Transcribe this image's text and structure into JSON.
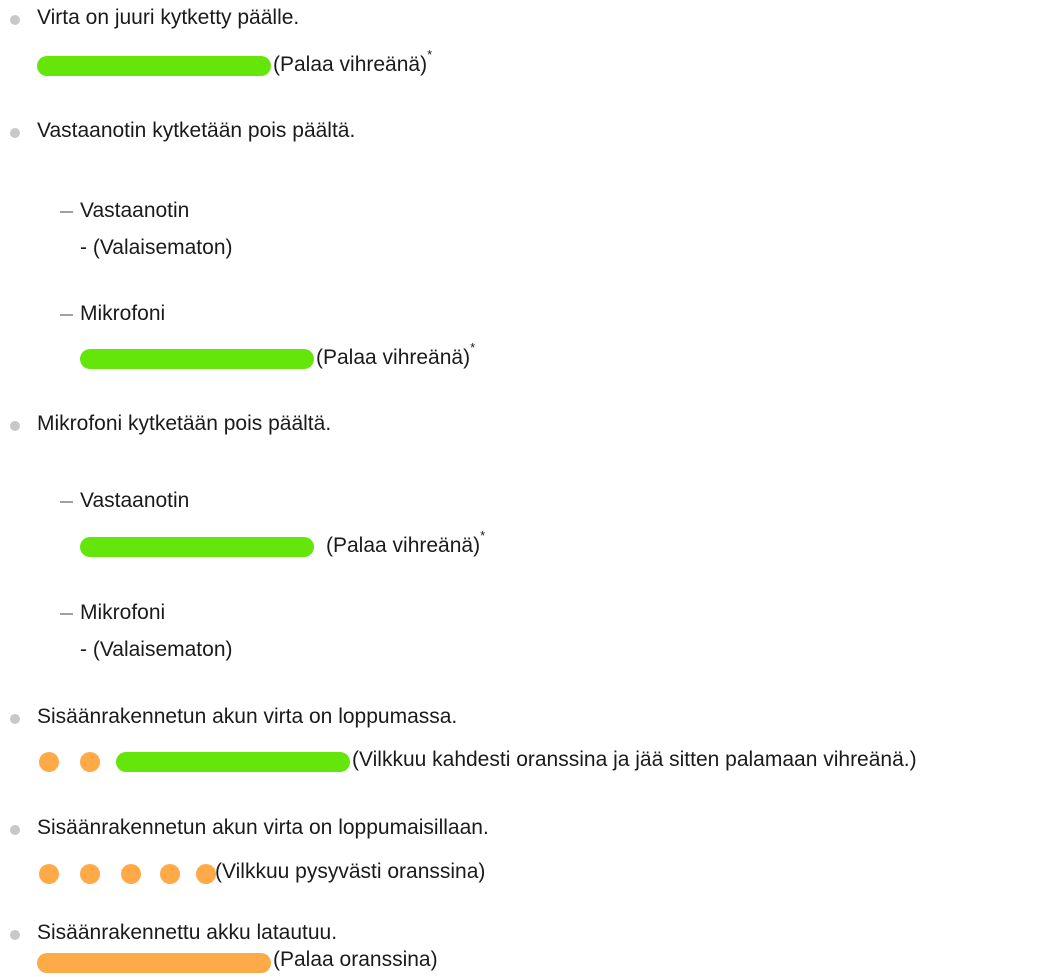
{
  "colors": {
    "green": "#65e60a",
    "orange": "#ffaa49",
    "bullet": "#c8c8c8"
  },
  "items": [
    {
      "label": "Virta on juuri kytketty päälle.",
      "indicator": "green-steady",
      "status": "(Palaa vihreänä)",
      "mark": "*"
    },
    {
      "label": "Vastaanotin kytketään pois päältä.",
      "sub": [
        {
          "label": "Vastaanotin",
          "status": "- (Valaisematon)"
        },
        {
          "label": "Mikrofoni",
          "indicator": "green-steady",
          "status": "(Palaa vihreänä)",
          "mark": "*"
        }
      ]
    },
    {
      "label": "Mikrofoni kytketään pois päältä.",
      "sub": [
        {
          "label": "Vastaanotin",
          "indicator": "green-steady",
          "status": "(Palaa vihreänä)",
          "mark": "*"
        },
        {
          "label": "Mikrofoni",
          "status": "- (Valaisematon)"
        }
      ]
    },
    {
      "label": "Sisäänrakennetun akun virta on loppumassa.",
      "indicator": "orange-blink-twice-then-green",
      "status": "(Vilkkuu kahdesti oranssina ja jää sitten palamaan vihreänä.)"
    },
    {
      "label": "Sisäänrakennetun akun virta on loppumaisillaan.",
      "indicator": "orange-blinking",
      "status": "(Vilkkuu pysyvästi oranssina)"
    },
    {
      "label": "Sisäänrakennettu akku latautuu.",
      "indicator": "orange-steady",
      "status": "(Palaa oranssina)"
    }
  ]
}
